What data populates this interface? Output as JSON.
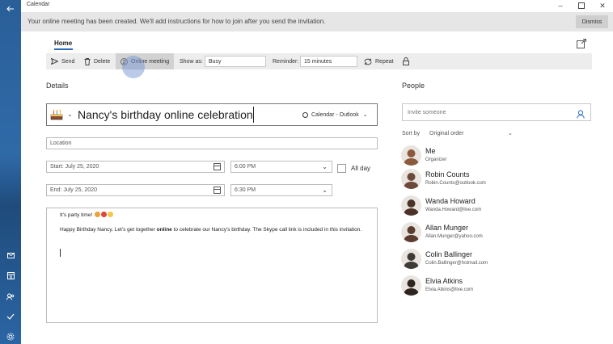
{
  "app": {
    "title": "Calendar"
  },
  "banner": {
    "message": "Your online meeting has been created. We'll add instructions for how to join after you send the invitation.",
    "dismiss": "Dismiss"
  },
  "tabs": {
    "home": "Home"
  },
  "toolbar": {
    "send": "Send",
    "delete": "Delete",
    "online_meeting": "Online meeting",
    "show_as_label": "Show as:",
    "show_as_value": "Busy",
    "reminder_label": "Reminder:",
    "reminder_value": "15 minutes",
    "repeat": "Repeat"
  },
  "details": {
    "heading": "Details",
    "title": "Nancy's birthday online celebration",
    "calendar": "Calendar - Outlook",
    "location_placeholder": "Location",
    "start_date": "Start: July 25, 2020",
    "start_time": "6:00 PM",
    "end_date": "End: July 25, 2020",
    "end_time": "6:30 PM",
    "all_day": "All day",
    "body_line1": "It's party time!",
    "body_pre": "Happy Birthday Nancy. Let's get together ",
    "body_bold": "online",
    "body_post": " to celebrate our Nancy's birthday. The Skype call link is included in this invitation."
  },
  "people": {
    "heading": "People",
    "invite_placeholder": "Invite someone",
    "sort_label": "Sort by",
    "sort_value": "Original order",
    "list": [
      {
        "name": "Me",
        "sub": "Organizer",
        "color": "#8b5a3c"
      },
      {
        "name": "Robin Counts",
        "sub": "Robin.Counts@outlook.com",
        "color": "#6b4a3a"
      },
      {
        "name": "Wanda Howard",
        "sub": "Wanda.Howard@live.com",
        "color": "#4a3228"
      },
      {
        "name": "Allan Munger",
        "sub": "Allan.Munger@yahoo.com",
        "color": "#5a3d2e"
      },
      {
        "name": "Colin Ballinger",
        "sub": "Colin.Ballinger@hotmail.com",
        "color": "#3e3a36"
      },
      {
        "name": "Elvia Atkins",
        "sub": "Elvia.Atkins@live.com",
        "color": "#2e2420"
      }
    ]
  },
  "colors": {
    "accent": "#2b6cb8",
    "rail": "#2f6aa8",
    "banner": "#e6e6e6",
    "toolbar": "#ededed"
  }
}
